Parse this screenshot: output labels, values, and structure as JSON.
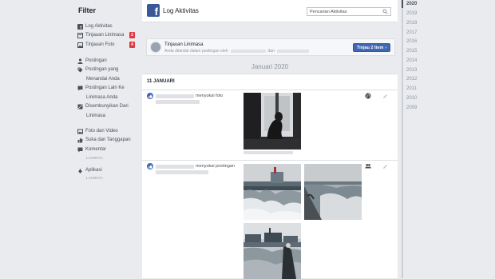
{
  "sidebar": {
    "title": "Filter",
    "items": [
      {
        "label": "Log Aktivitas",
        "icon": "facebook-icon"
      },
      {
        "label": "Tinjauan Linimasa",
        "icon": "timeline-review-icon",
        "badge": "2"
      },
      {
        "label": "Tinjauan Foto",
        "icon": "photo-review-icon",
        "badge": "4"
      }
    ],
    "groups": [
      {
        "label": "Postingan",
        "icon": "person-icon"
      },
      {
        "label": "Postingan yang",
        "icon": "tag-icon",
        "sub": "Menandai Anda"
      },
      {
        "label": "Postingan Lain Ke",
        "icon": "comment-icon",
        "sub": "Linimasa Anda"
      },
      {
        "label": "Disembunyikan Dari",
        "icon": "hidden-icon",
        "sub": "Linimasa"
      },
      {
        "label": "Foto dan Video",
        "icon": "photo-icon"
      },
      {
        "label": "Suka dan Tanggapan",
        "icon": "like-icon"
      },
      {
        "label": "Komentar",
        "icon": "comment-icon"
      },
      {
        "label": "Aplikasi",
        "icon": "apps-icon"
      }
    ],
    "more_label": "LAINNYA"
  },
  "header": {
    "title": "Log Aktivitas",
    "search_placeholder": "Pencarian Aktivitas"
  },
  "review": {
    "title": "Tinjauan Linimasa",
    "sub_prefix": "Anda ditandai dalam postingan oleh",
    "sub_mid": "dan",
    "button_label": "Tinjau 2 Item",
    "button_arrow": "›"
  },
  "month_label": "Januari 2020",
  "day_label": "11 JANUARI",
  "activities": [
    {
      "action": "menyukai foto",
      "privacy_icon": "globe-icon"
    },
    {
      "action": "menyukai postingan",
      "privacy_icon": "friends-icon"
    }
  ],
  "years": [
    "2020",
    "2019",
    "2018",
    "2017",
    "2016",
    "2015",
    "2014",
    "2013",
    "2012",
    "2011",
    "2010",
    "2009"
  ],
  "colors": {
    "brand": "#3b5998",
    "button": "#4267b2",
    "badge": "#e0393e",
    "background": "#e9ebee"
  }
}
